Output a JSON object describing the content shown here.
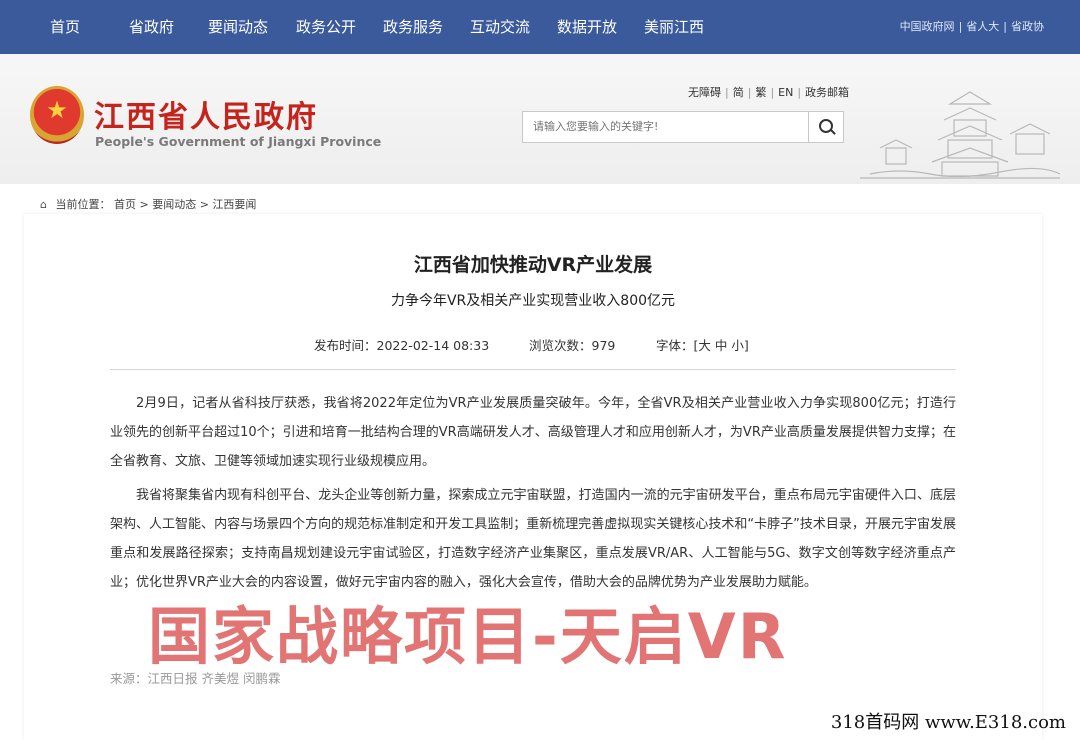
{
  "nav": {
    "items": [
      "首页",
      "省政府",
      "要闻动态",
      "政务公开",
      "政务服务",
      "互动交流",
      "数据开放",
      "美丽江西"
    ],
    "right_links": [
      "中国政府网",
      "省人大",
      "省政协"
    ]
  },
  "header": {
    "site_name_cn": "江西省人民政府",
    "site_name_en": "People's Government of Jiangxi Province",
    "utility_links": [
      "无障碍",
      "简",
      "繁",
      "EN",
      "政务邮箱"
    ],
    "search_placeholder": "请输入您要输入的关键字!"
  },
  "breadcrumb": {
    "label": "当前位置：",
    "items": [
      "首页",
      "要闻动态",
      "江西要闻"
    ],
    "separator": ">"
  },
  "article": {
    "title": "江西省加快推动VR产业发展",
    "subtitle": "力争今年VR及相关产业实现营业收入800亿元",
    "publish_time": "发布时间：2022-02-14 08:33",
    "views": "浏览次数：979",
    "font_label": "字体：[",
    "font_sizes": [
      "大",
      "中",
      "小"
    ],
    "font_close": "]",
    "paragraphs": [
      "2月9日，记者从省科技厅获悉，我省将2022年定位为VR产业发展质量突破年。今年，全省VR及相关产业营业收入力争实现800亿元；打造行业领先的创新平台超过10个；引进和培育一批结构合理的VR高端研发人才、高级管理人才和应用创新人才，为VR产业高质量发展提供智力支撑；在全省教育、文旅、卫健等领域加速实现行业级规模应用。",
      "我省将聚集省内现有科创平台、龙头企业等创新力量，探索成立元宇宙联盟，打造国内一流的元宇宙研发平台，重点布局元宇宙硬件入口、底层架构、人工智能、内容与场景四个方向的规范标准制定和开发工具监制；重新梳理完善虚拟现实关键核心技术和“卡脖子”技术目录，开展元宇宙发展重点和发展路径探索；支持南昌规划建设元宇宙试验区，打造数字经济产业集聚区，重点发展VR/AR、人工智能与5G、数字文创等数字经济重点产业；优化世界VR产业大会的内容设置，做好元宇宙内容的融入，强化大会宣传，借助大会的品牌优势为产业发展助力赋能。"
    ],
    "source": "来源：江西日报 齐美煜 闵鹏霖"
  },
  "overlay": {
    "watermark": "国家战略项目-天启VR",
    "corner_text": "318首码网 www.E318.com"
  },
  "colors": {
    "nav_bg": "#3a5a9c",
    "brand_red": "#c4241c",
    "watermark": "#e06a6a"
  }
}
